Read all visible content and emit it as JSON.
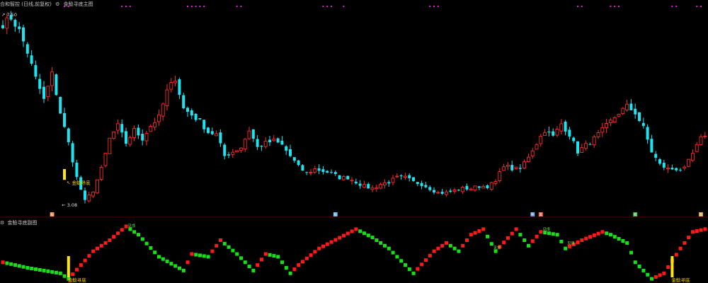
{
  "header": {
    "stock_title": "合和智控 (日线,前复权)",
    "main_indicator": "金鲶寻底主图",
    "sub_indicator": "金鲶寻底副图"
  },
  "colors": {
    "up": "#ff2a2a",
    "down": "#1fe3f0",
    "signal_yellow": "#ffe600",
    "signal_text": "#ffd400",
    "ribbon_red": "#ff1a1a",
    "ribbon_green": "#18e018",
    "top_marker": "#d02cd0",
    "separator": "#5a0000"
  },
  "chart_data": [
    {
      "type": "candlestick",
      "name": "main",
      "price_labels": {
        "high": "7.50",
        "low": "3.08"
      },
      "high_value": 7.5,
      "low_value": 3.08,
      "ylim": [
        2.9,
        7.65
      ],
      "signal_label": "金鲶寻底",
      "bottom_badges": [
        "股",
        "股",
        "明",
        "关",
        "买",
        "B"
      ],
      "top_marker_count": 28,
      "grid": false,
      "anchors": [
        [
          0,
          7.25
        ],
        [
          2,
          7.4
        ],
        [
          4,
          7.1
        ],
        [
          6,
          6.6
        ],
        [
          8,
          6.0
        ],
        [
          10,
          5.5
        ],
        [
          12,
          6.1
        ],
        [
          14,
          5.2
        ],
        [
          16,
          4.5
        ],
        [
          18,
          3.7
        ],
        [
          20,
          3.15
        ],
        [
          22,
          3.4
        ],
        [
          24,
          3.9
        ],
        [
          26,
          4.6
        ],
        [
          28,
          4.9
        ],
        [
          30,
          4.5
        ],
        [
          32,
          4.8
        ],
        [
          34,
          4.6
        ],
        [
          36,
          4.9
        ],
        [
          38,
          5.1
        ],
        [
          40,
          5.7
        ],
        [
          42,
          6.0
        ],
        [
          44,
          5.3
        ],
        [
          46,
          5.15
        ],
        [
          48,
          5.0
        ],
        [
          50,
          4.75
        ],
        [
          52,
          4.7
        ],
        [
          54,
          4.2
        ],
        [
          56,
          4.3
        ],
        [
          58,
          4.4
        ],
        [
          60,
          4.8
        ],
        [
          62,
          4.4
        ],
        [
          64,
          4.5
        ],
        [
          66,
          4.55
        ],
        [
          68,
          4.45
        ],
        [
          70,
          4.2
        ],
        [
          72,
          3.95
        ],
        [
          74,
          3.8
        ],
        [
          76,
          3.9
        ],
        [
          78,
          3.85
        ],
        [
          80,
          3.8
        ],
        [
          82,
          3.7
        ],
        [
          84,
          3.7
        ],
        [
          86,
          3.6
        ],
        [
          88,
          3.5
        ],
        [
          90,
          3.45
        ],
        [
          92,
          3.55
        ],
        [
          94,
          3.6
        ],
        [
          96,
          3.7
        ],
        [
          98,
          3.7
        ],
        [
          100,
          3.6
        ],
        [
          102,
          3.55
        ],
        [
          104,
          3.45
        ],
        [
          106,
          3.35
        ],
        [
          108,
          3.35
        ],
        [
          110,
          3.4
        ],
        [
          112,
          3.45
        ],
        [
          114,
          3.45
        ],
        [
          116,
          3.5
        ],
        [
          118,
          3.5
        ],
        [
          120,
          3.6
        ],
        [
          122,
          4.0
        ],
        [
          124,
          3.9
        ],
        [
          126,
          3.9
        ],
        [
          128,
          4.2
        ],
        [
          130,
          4.5
        ],
        [
          132,
          4.8
        ],
        [
          134,
          4.65
        ],
        [
          136,
          4.95
        ],
        [
          138,
          4.7
        ],
        [
          140,
          4.3
        ],
        [
          142,
          4.45
        ],
        [
          144,
          4.6
        ],
        [
          146,
          4.8
        ],
        [
          148,
          5.0
        ],
        [
          150,
          5.2
        ],
        [
          152,
          5.35
        ],
        [
          154,
          5.2
        ],
        [
          156,
          4.85
        ],
        [
          158,
          4.3
        ],
        [
          160,
          4.0
        ],
        [
          162,
          3.9
        ],
        [
          164,
          3.9
        ],
        [
          166,
          3.9
        ],
        [
          168,
          4.25
        ],
        [
          170,
          4.6
        ],
        [
          171,
          4.7
        ]
      ]
    },
    {
      "type": "ribbon",
      "name": "sub",
      "signal_label": "金鲶寻底",
      "top_labels": [
        "见顶",
        "见顶",
        "见顶",
        "见顶"
      ],
      "anchors": [
        [
          0,
          0.35
        ],
        [
          6,
          0.25
        ],
        [
          14,
          0.15
        ],
        [
          16,
          0.05
        ],
        [
          22,
          0.55
        ],
        [
          26,
          0.75
        ],
        [
          30,
          1.0
        ],
        [
          33,
          0.85
        ],
        [
          38,
          0.45
        ],
        [
          44,
          0.2
        ],
        [
          46,
          0.5
        ],
        [
          50,
          0.45
        ],
        [
          53,
          0.75
        ],
        [
          57,
          0.5
        ],
        [
          61,
          0.2
        ],
        [
          64,
          0.5
        ],
        [
          67,
          0.45
        ],
        [
          70,
          0.15
        ],
        [
          72,
          0.3
        ],
        [
          77,
          0.6
        ],
        [
          86,
          0.95
        ],
        [
          90,
          0.8
        ],
        [
          94,
          0.6
        ],
        [
          100,
          0.15
        ],
        [
          105,
          0.55
        ],
        [
          108,
          0.7
        ],
        [
          111,
          0.55
        ],
        [
          114,
          0.85
        ],
        [
          117,
          0.95
        ],
        [
          120,
          0.55
        ],
        [
          125,
          0.95
        ],
        [
          128,
          0.65
        ],
        [
          131,
          0.9
        ],
        [
          135,
          0.85
        ],
        [
          137,
          0.6
        ],
        [
          141,
          0.75
        ],
        [
          146,
          0.9
        ],
        [
          148,
          0.85
        ],
        [
          152,
          0.7
        ],
        [
          154,
          0.35
        ],
        [
          158,
          0.05
        ],
        [
          161,
          0.15
        ],
        [
          165,
          0.6
        ],
        [
          168,
          0.9
        ],
        [
          171,
          0.95
        ]
      ]
    }
  ]
}
